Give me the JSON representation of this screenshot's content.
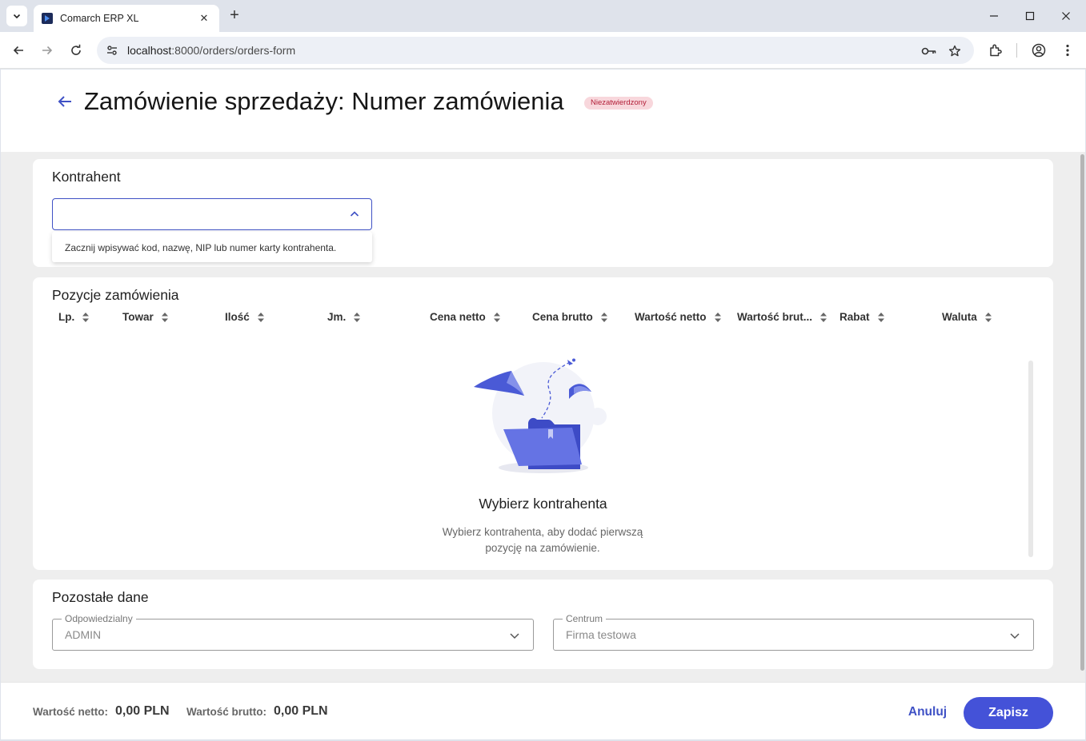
{
  "browser": {
    "tab_title": "Comarch ERP XL",
    "url_host": "localhost",
    "url_path": ":8000/orders/orders-form"
  },
  "header": {
    "title": "Zamówienie sprzedaży: Numer zamówienia",
    "status_badge": "Niezatwierdzony"
  },
  "contractor": {
    "title": "Kontrahent",
    "input_value": "",
    "hint": "Zacznij wpisywać kod, nazwę, NIP lub numer karty kontrahenta."
  },
  "order_items": {
    "title": "Pozycje zamówienia",
    "columns": [
      "Lp.",
      "Towar",
      "Ilość",
      "Jm.",
      "Cena netto",
      "Cena brutto",
      "Wartość netto",
      "Wartość brut...",
      "Rabat",
      "Waluta"
    ],
    "empty_title": "Wybierz kontrahenta",
    "empty_text": "Wybierz kontrahenta, aby dodać pierwszą pozycję na zamówienie."
  },
  "other_data": {
    "title": "Pozostałe dane",
    "responsible_label": "Odpowiedzialny",
    "responsible_value": "ADMIN",
    "center_label": "Centrum",
    "center_value": "Firma testowa"
  },
  "footer": {
    "net_label": "Wartość netto:",
    "net_value": "0,00 PLN",
    "gross_label": "Wartość brutto:",
    "gross_value": "0,00 PLN",
    "cancel_label": "Anuluj",
    "save_label": "Zapisz"
  },
  "colors": {
    "accent": "#4452d8",
    "badge_bg": "#f8d7dc",
    "badge_text": "#b21d37"
  }
}
